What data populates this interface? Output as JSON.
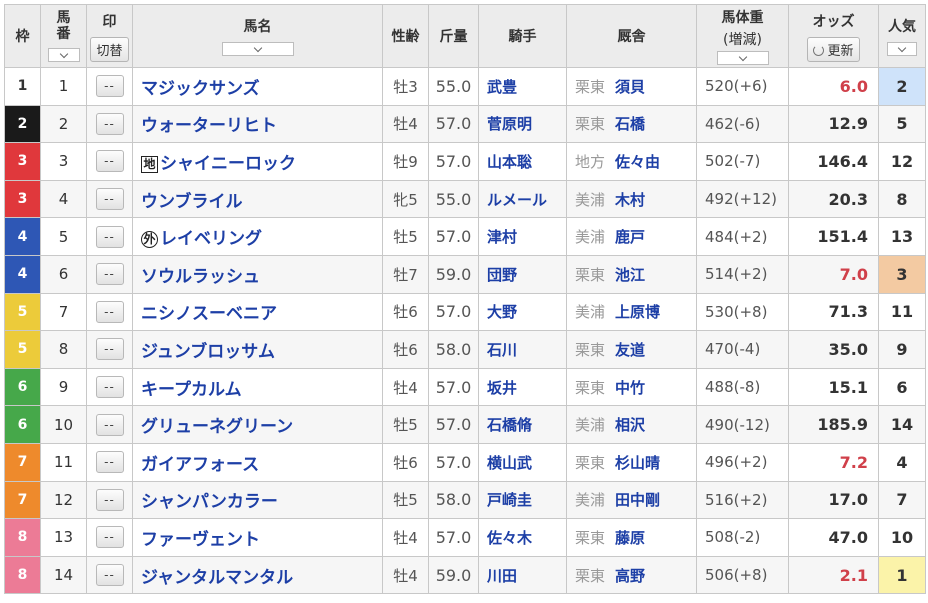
{
  "header": {
    "waku": "枠",
    "umaban": "馬番",
    "mark": "印",
    "mark_toggle": "切替",
    "name": "馬名",
    "sex_age": "性齢",
    "weight": "斤量",
    "jockey": "騎手",
    "stable": "厩舎",
    "body_weight": "馬体重",
    "body_weight_sub": "(増減)",
    "odds": "オッズ",
    "odds_refresh": "更新",
    "popularity": "人気"
  },
  "mark_placeholder": "--",
  "colors": {
    "waku1": "#ffffff",
    "waku2": "#1a1a1a",
    "waku3": "#e0383c",
    "waku4": "#2e57b5",
    "waku5": "#eccb3a",
    "waku6": "#46a84a",
    "waku7": "#ee8a2c",
    "waku8": "#ec7b96",
    "link": "#1d3fa6",
    "odds_highlight": "#d0404a",
    "pop1": "#fbf3a9",
    "pop2": "#cfe3fa",
    "pop3": "#f3caa2"
  },
  "rows": [
    {
      "waku": "1",
      "umaban": "1",
      "badge": "",
      "name": "マジックサンズ",
      "sex_age": "牡3",
      "weight": "55.0",
      "jockey": "武豊",
      "region": "栗東",
      "trainer": "須貝",
      "body_weight": "520(+6)",
      "odds": "6.0",
      "popularity": "2"
    },
    {
      "waku": "2",
      "umaban": "2",
      "badge": "",
      "name": "ウォーターリヒト",
      "sex_age": "牡4",
      "weight": "57.0",
      "jockey": "菅原明",
      "region": "栗東",
      "trainer": "石橋",
      "body_weight": "462(-6)",
      "odds": "12.9",
      "popularity": "5"
    },
    {
      "waku": "3",
      "umaban": "3",
      "badge": "地",
      "name": "シャイニーロック",
      "sex_age": "牡9",
      "weight": "57.0",
      "jockey": "山本聡",
      "region": "地方",
      "trainer": "佐々由",
      "body_weight": "502(-7)",
      "odds": "146.4",
      "popularity": "12"
    },
    {
      "waku": "3",
      "umaban": "4",
      "badge": "",
      "name": "ウンブライル",
      "sex_age": "牝5",
      "weight": "55.0",
      "jockey": "ルメール",
      "region": "美浦",
      "trainer": "木村",
      "body_weight": "492(+12)",
      "odds": "20.3",
      "popularity": "8"
    },
    {
      "waku": "4",
      "umaban": "5",
      "badge": "外",
      "name": "レイベリング",
      "sex_age": "牡5",
      "weight": "57.0",
      "jockey": "津村",
      "region": "美浦",
      "trainer": "鹿戸",
      "body_weight": "484(+2)",
      "odds": "151.4",
      "popularity": "13"
    },
    {
      "waku": "4",
      "umaban": "6",
      "badge": "",
      "name": "ソウルラッシュ",
      "sex_age": "牡7",
      "weight": "59.0",
      "jockey": "団野",
      "region": "栗東",
      "trainer": "池江",
      "body_weight": "514(+2)",
      "odds": "7.0",
      "popularity": "3"
    },
    {
      "waku": "5",
      "umaban": "7",
      "badge": "",
      "name": "ニシノスーベニア",
      "sex_age": "牡6",
      "weight": "57.0",
      "jockey": "大野",
      "region": "美浦",
      "trainer": "上原博",
      "body_weight": "530(+8)",
      "odds": "71.3",
      "popularity": "11"
    },
    {
      "waku": "5",
      "umaban": "8",
      "badge": "",
      "name": "ジュンブロッサム",
      "sex_age": "牡6",
      "weight": "58.0",
      "jockey": "石川",
      "region": "栗東",
      "trainer": "友道",
      "body_weight": "470(-4)",
      "odds": "35.0",
      "popularity": "9"
    },
    {
      "waku": "6",
      "umaban": "9",
      "badge": "",
      "name": "キープカルム",
      "sex_age": "牡4",
      "weight": "57.0",
      "jockey": "坂井",
      "region": "栗東",
      "trainer": "中竹",
      "body_weight": "488(-8)",
      "odds": "15.1",
      "popularity": "6"
    },
    {
      "waku": "6",
      "umaban": "10",
      "badge": "",
      "name": "グリューネグリーン",
      "sex_age": "牡5",
      "weight": "57.0",
      "jockey": "石橋脩",
      "region": "美浦",
      "trainer": "相沢",
      "body_weight": "490(-12)",
      "odds": "185.9",
      "popularity": "14"
    },
    {
      "waku": "7",
      "umaban": "11",
      "badge": "",
      "name": "ガイアフォース",
      "sex_age": "牡6",
      "weight": "57.0",
      "jockey": "横山武",
      "region": "栗東",
      "trainer": "杉山晴",
      "body_weight": "496(+2)",
      "odds": "7.2",
      "popularity": "4"
    },
    {
      "waku": "7",
      "umaban": "12",
      "badge": "",
      "name": "シャンパンカラー",
      "sex_age": "牡5",
      "weight": "58.0",
      "jockey": "戸崎圭",
      "region": "美浦",
      "trainer": "田中剛",
      "body_weight": "516(+2)",
      "odds": "17.0",
      "popularity": "7"
    },
    {
      "waku": "8",
      "umaban": "13",
      "badge": "",
      "name": "ファーヴェント",
      "sex_age": "牡4",
      "weight": "57.0",
      "jockey": "佐々木",
      "region": "栗東",
      "trainer": "藤原",
      "body_weight": "508(-2)",
      "odds": "47.0",
      "popularity": "10"
    },
    {
      "waku": "8",
      "umaban": "14",
      "badge": "",
      "name": "ジャンタルマンタル",
      "sex_age": "牡4",
      "weight": "59.0",
      "jockey": "川田",
      "region": "栗東",
      "trainer": "高野",
      "body_weight": "506(+8)",
      "odds": "2.1",
      "popularity": "1"
    }
  ]
}
